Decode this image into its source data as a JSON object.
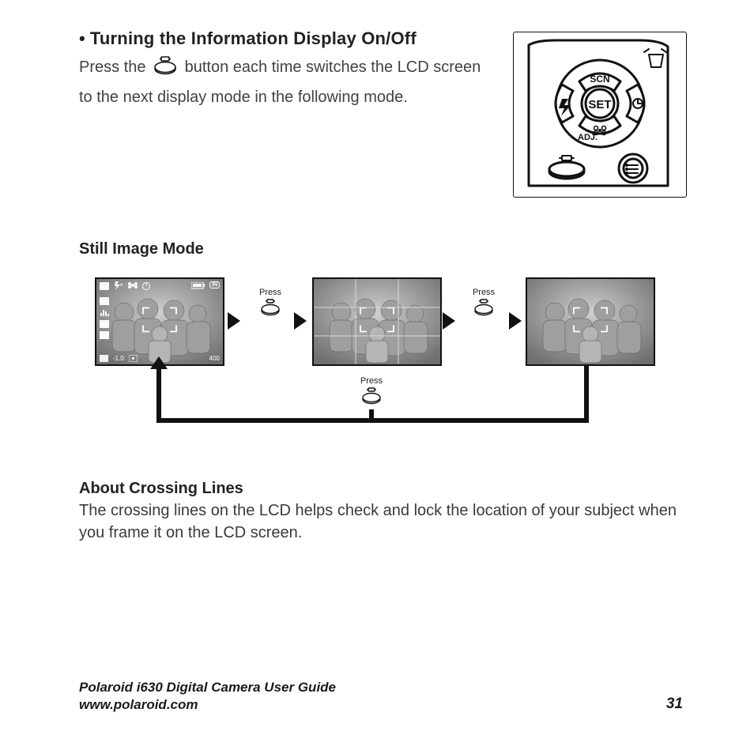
{
  "section": {
    "bullet": "•",
    "title": "Turning the Information Display On/Off",
    "para_pre": "Press the ",
    "para_post": " button each time switches the LCD screen to the next display mode in the following mode."
  },
  "still_image_heading": "Still Image Mode",
  "diagram": {
    "press_label": "Press",
    "overlay": {
      "in_badge": "IN",
      "ev_label": "-1.0",
      "iso_label": "400",
      "icons_alt": {
        "camera": "camera-icon",
        "flash_auto": "flash-auto-icon",
        "macro": "macro-icon",
        "timer": "self-timer-icon",
        "battery": "battery-icon",
        "size": "image-size-6m-icon",
        "histogram": "histogram-icon",
        "quality": "quality-icon",
        "wb": "white-balance-icon",
        "ev_comp": "ev-comp-icon",
        "meter": "metering-icon"
      }
    }
  },
  "about": {
    "heading": "About Crossing Lines",
    "text": "The crossing lines on the LCD helps check and lock the location of your subject when you frame it on the LCD screen."
  },
  "footer": {
    "guide": "Polaroid i630 Digital Camera User Guide",
    "url": "www.polaroid.com",
    "page": "31"
  },
  "camera_panel": {
    "set_label": "SET",
    "scn_label": "SCN",
    "adj_label": "ADJ."
  }
}
